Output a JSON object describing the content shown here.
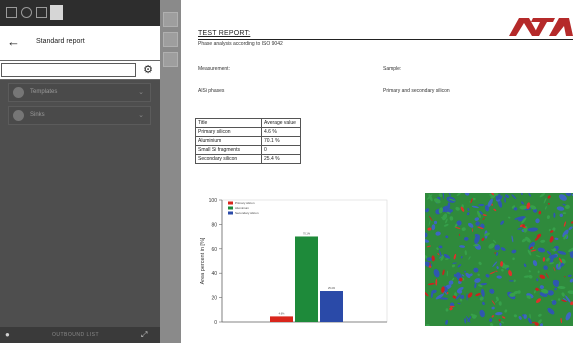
{
  "app": {
    "header": {
      "small_label": "",
      "title": "Standard report"
    },
    "search": {
      "value": "",
      "placeholder": ""
    },
    "dropdowns": [
      {
        "label": "Templates",
        "icon": "layers-icon"
      },
      {
        "label": "Sinks",
        "icon": "user-icon"
      }
    ],
    "bottom_bar": {
      "center_label": "OUTBOUND LIST"
    }
  },
  "report": {
    "title": "TEST REPORT:",
    "subtitle": "Phase analysis according to ISO 9042",
    "fields": {
      "measurement_label": "Measurement:",
      "measurement_value": "AlSi phases",
      "sample_label": "Sample:",
      "sample_value": "Primary and secondary silicon"
    },
    "table": {
      "headers": [
        "Title",
        "Average value"
      ],
      "rows": [
        [
          "Primary silicon",
          "4.6 %"
        ],
        [
          "Aluminium",
          "70.1 %"
        ],
        [
          "Small Si fragments",
          "0"
        ],
        [
          "Secondary silicon",
          "25.4 %"
        ]
      ]
    },
    "logo_color": "#b52a2a"
  },
  "chart_data": {
    "type": "bar",
    "categories": [
      "Primary silicon",
      "Aluminium",
      "Secondary silicon"
    ],
    "values": [
      4.6,
      70.1,
      25.4
    ],
    "value_labels": [
      "4.6%",
      "70.1%",
      "25.4%"
    ],
    "colors": [
      "#d9261c",
      "#1e8a3a",
      "#2a4aa8"
    ],
    "legend": [
      "Primary silicon",
      "Aluminium",
      "Secondary silicon"
    ],
    "legend_position": "top-left",
    "ylabel": "Area percent in [%]",
    "xlabel": "",
    "ylim": [
      0,
      100
    ],
    "yticks": [
      0,
      20,
      40,
      60,
      80,
      100
    ],
    "grid": false
  }
}
